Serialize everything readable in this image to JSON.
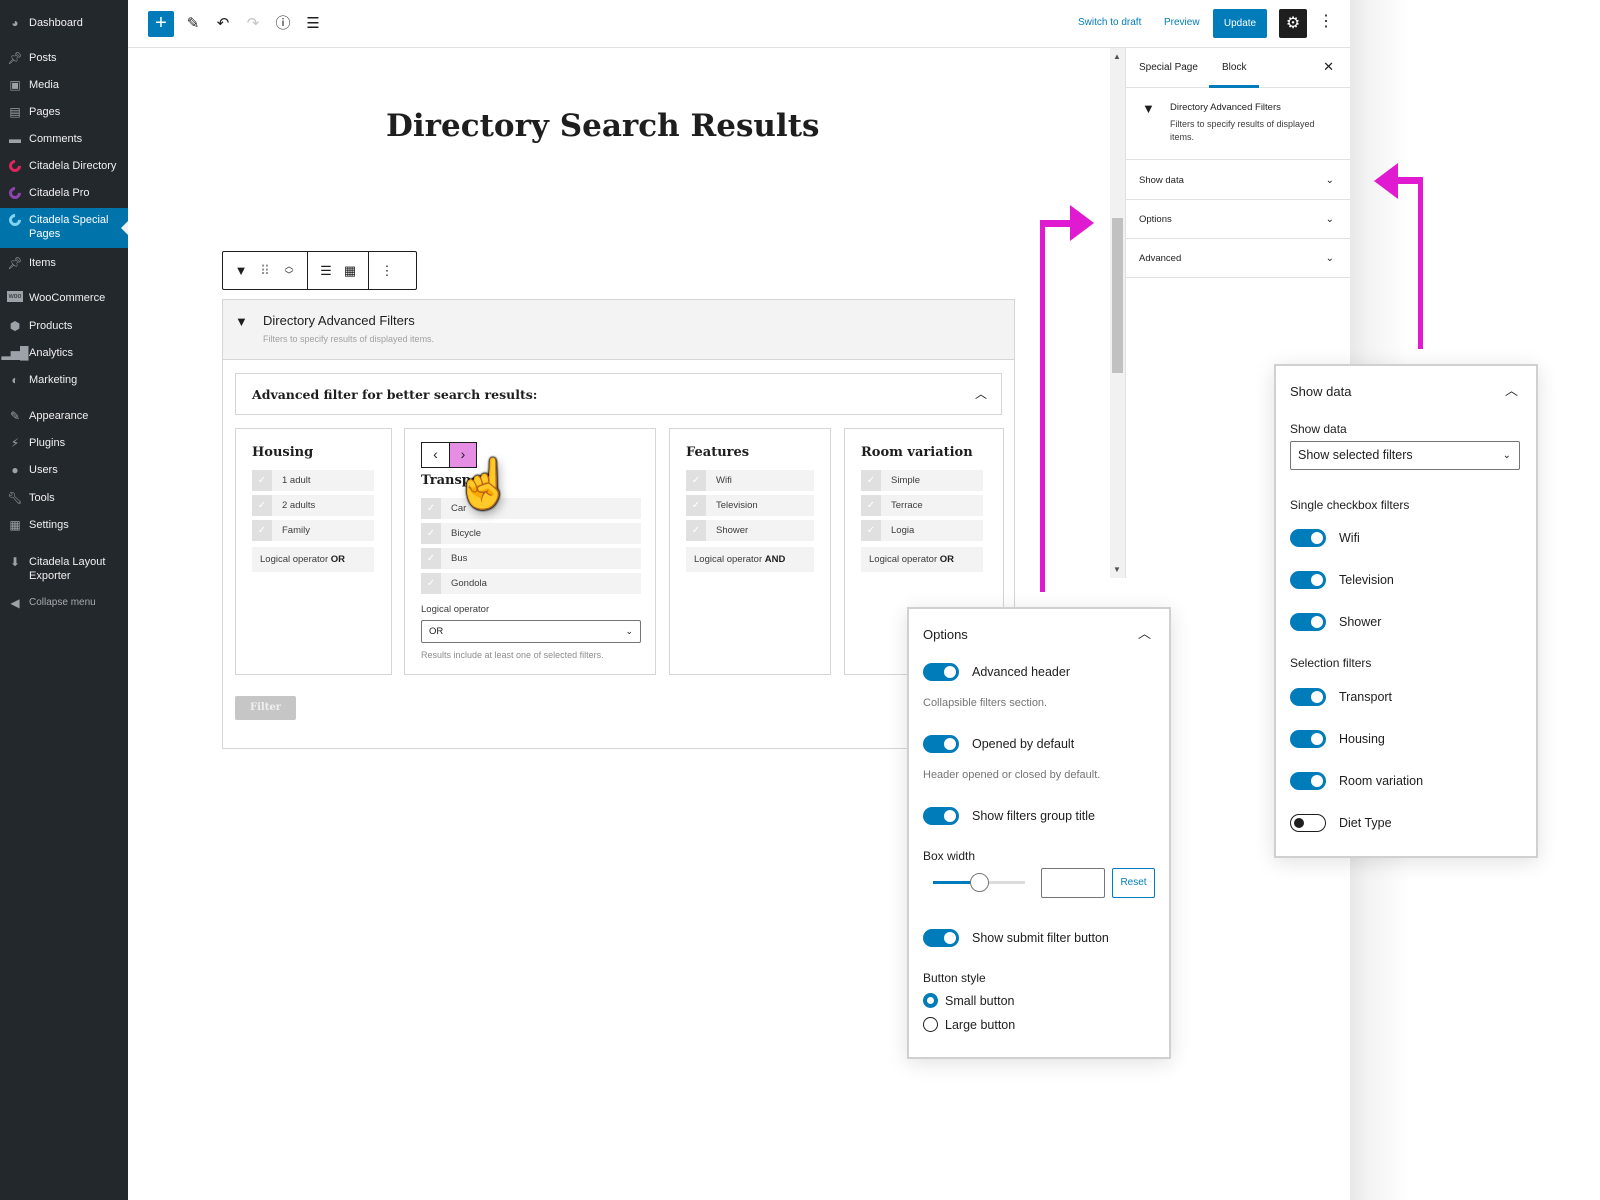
{
  "admin_sidebar": {
    "items": [
      {
        "label": "Dashboard",
        "icon": "dashboard-icon"
      },
      {
        "label": "Posts",
        "icon": "pin-icon"
      },
      {
        "label": "Media",
        "icon": "media-icon"
      },
      {
        "label": "Pages",
        "icon": "pages-icon"
      },
      {
        "label": "Comments",
        "icon": "comment-icon"
      },
      {
        "label": "Citadela Directory",
        "icon": "citadela-icon",
        "color": "#e0245e"
      },
      {
        "label": "Citadela Pro",
        "icon": "citadela-icon",
        "color": "#8e44ad"
      },
      {
        "label": "Citadela Special Pages",
        "icon": "citadela-icon",
        "color": "#2ea2cc",
        "active": true
      },
      {
        "label": "Items",
        "icon": "pin-icon"
      },
      {
        "label": "WooCommerce",
        "icon": "woo-icon"
      },
      {
        "label": "Products",
        "icon": "box-icon"
      },
      {
        "label": "Analytics",
        "icon": "bar-chart-icon"
      },
      {
        "label": "Marketing",
        "icon": "megaphone-icon"
      },
      {
        "label": "Appearance",
        "icon": "brush-icon"
      },
      {
        "label": "Plugins",
        "icon": "plug-icon"
      },
      {
        "label": "Users",
        "icon": "user-icon"
      },
      {
        "label": "Tools",
        "icon": "wrench-icon"
      },
      {
        "label": "Settings",
        "icon": "settings-icon"
      },
      {
        "label": "Citadela Layout Exporter",
        "icon": "export-icon"
      },
      {
        "label": "Collapse menu",
        "icon": "collapse-icon"
      }
    ]
  },
  "toolbar": {
    "switch_to_draft": "Switch to draft",
    "preview": "Preview",
    "update": "Update"
  },
  "editor": {
    "page_title": "Directory Search Results",
    "block": {
      "title": "Directory Advanced Filters",
      "description": "Filters to specify results of displayed items.",
      "advanced_header": "Advanced filter for better search results:",
      "filter_button": "Filter",
      "groups": [
        {
          "title": "Housing",
          "options": [
            "1 adult",
            "2 adults",
            "Family"
          ],
          "operator_prefix": "Logical operator",
          "operator": "OR"
        },
        {
          "title": "Transport",
          "options": [
            "Car",
            "Bicycle",
            "Bus",
            "Gondola"
          ],
          "select_label": "Logical operator",
          "select_value": "OR",
          "help": "Results include at least one of selected filters."
        },
        {
          "title": "Features",
          "options": [
            "Wifi",
            "Television",
            "Shower"
          ],
          "operator_prefix": "Logical operator",
          "operator": "AND"
        },
        {
          "title": "Room variation",
          "options": [
            "Simple",
            "Terrace",
            "Logia"
          ],
          "operator_prefix": "Logical operator",
          "operator": "OR"
        }
      ]
    }
  },
  "settings_sidebar": {
    "tabs": [
      "Special Page",
      "Block"
    ],
    "active_tab": "Block",
    "block_title": "Directory Advanced Filters",
    "block_description": "Filters to specify results of displayed items.",
    "panels": [
      "Show data",
      "Options",
      "Advanced"
    ]
  },
  "options_panel": {
    "title": "Options",
    "advanced_header": {
      "label": "Advanced header",
      "on": true,
      "help": "Collapsible filters section."
    },
    "opened_by_default": {
      "label": "Opened by default",
      "on": true,
      "help": "Header opened or closed by default."
    },
    "show_group_title": {
      "label": "Show filters group title",
      "on": true
    },
    "box_width": {
      "label": "Box width",
      "value": "",
      "slider_fraction": 0.5,
      "reset_label": "Reset"
    },
    "show_submit": {
      "label": "Show submit filter button",
      "on": true
    },
    "button_style": {
      "label": "Button style",
      "options": [
        "Small button",
        "Large button"
      ],
      "selected": "Small button"
    }
  },
  "show_data_panel": {
    "title": "Show data",
    "select_label": "Show data",
    "select_value": "Show selected filters",
    "single_checkbox_label": "Single checkbox filters",
    "single_checkbox": [
      {
        "label": "Wifi",
        "on": true
      },
      {
        "label": "Television",
        "on": true
      },
      {
        "label": "Shower",
        "on": true
      }
    ],
    "selection_label": "Selection filters",
    "selection": [
      {
        "label": "Transport",
        "on": true
      },
      {
        "label": "Housing",
        "on": true
      },
      {
        "label": "Room variation",
        "on": true
      },
      {
        "label": "Diet Type",
        "on": false
      }
    ]
  },
  "colors": {
    "accent": "#007cba",
    "admin_bg": "#23282d",
    "highlight": "#e01ad0",
    "nav_next_bg": "#e58ee3"
  }
}
